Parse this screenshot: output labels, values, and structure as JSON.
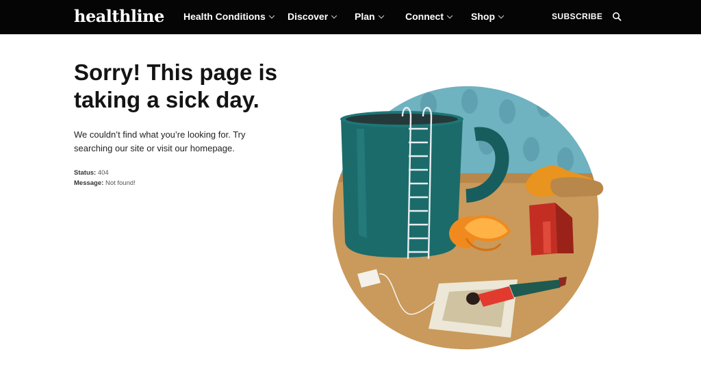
{
  "header": {
    "logo_text": "healthline",
    "nav": [
      {
        "label": "Health Conditions"
      },
      {
        "label": "Discover"
      },
      {
        "label": "Plan"
      },
      {
        "label": "Connect"
      },
      {
        "label": "Shop"
      }
    ],
    "subscribe_label": "SUBSCRIBE",
    "search_icon": "search-icon"
  },
  "error": {
    "headline": "Sorry! This page is taking a sick day.",
    "description": "We couldn’t find what you’re looking for. Try searching our site or visit our homepage.",
    "status_label": "Status:",
    "status_value": "404",
    "message_label": "Message:",
    "message_value": "Not found!"
  },
  "colors": {
    "header_bg": "#050505",
    "mug_teal": "#1b6b6b",
    "wall_blue": "#6fb2c0",
    "table_tan": "#c99a5c",
    "orange": "#f08a1e",
    "red_block": "#c42e22"
  }
}
